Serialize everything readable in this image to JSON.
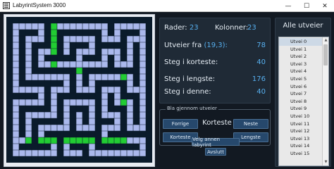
{
  "window": {
    "title": "LabyrintSystem 3000",
    "minimize": "—",
    "maximize": "☐",
    "close": "✕"
  },
  "info": {
    "rader_label": "Rader:",
    "rader_value": "23",
    "kolonner_label": "Kolonner:",
    "kolonner_value": "23",
    "utveier_label": "Utveier fra",
    "utveier_from": "(19,3):",
    "utveier_value": "78",
    "korteste_label": "Steg i korteste:",
    "korteste_value": "40",
    "lengste_label": "Steg i lengste:",
    "lengste_value": "176",
    "denne_label": "Steg i denne:",
    "denne_value": "40"
  },
  "browse": {
    "title": "Bla gjennom utveier",
    "current_label": "Korteste",
    "forrige": "Forrige",
    "neste": "Neste",
    "korteste": "Korteste",
    "lengste": "Lengste"
  },
  "actions": {
    "velg_annen": "Velg annen labyrint",
    "avslutt": "Avslutt"
  },
  "list": {
    "title": "Alle utveier",
    "items": [
      "Utvei 0",
      "Utvei 1",
      "Utvei 2",
      "Utvei 3",
      "Utvei 4",
      "Utvei 5",
      "Utvei 6",
      "Utvei 7",
      "Utvei 8",
      "Utvei 9",
      "Utvei 10",
      "Utvei 11",
      "Utvei 12",
      "Utvei 13",
      "Utvei 14",
      "Utvei 15"
    ],
    "selected": 0
  },
  "maze": {
    "rows": [
      "#######################",
      "#.....#.........#.....#",
      "#.###.#.#######.#.###.#",
      "#.#...#.#.....#...#...#",
      "#.#.###.#.###.#####.#.#",
      "#.#.#...#.#...#...#.#.#",
      "#.#.#.#####.###.#.#.#.#",
      "#.#.#...........#...#.#",
      "#.#.#######.#########.#",
      "#.#.......#.#.......#.#",
      "#.#######.#.#.#####.#.#",
      "#.....#...#...#...#...#",
      "#####.#.#######.#.###.#",
      "#.....#.#.....#.#...#.#",
      "#.#####.#.###.#.###.#.#",
      "#.#.....#.#.#.#...#.#.#",
      "#.#.#####.#.#.###.#.#.#",
      "#.#.#.....#...#...#...#",
      "#.#.#.#########.#######",
      "#...#...#.....#.......#",
      "#.#####.#.###.#######.#",
      "#.......#...#.........#",
      "#######################"
    ],
    "path": [
      [
        19,
        3
      ],
      [
        19,
        4
      ],
      [
        19,
        5
      ],
      [
        19,
        6
      ],
      [
        19,
        7
      ],
      [
        19,
        8
      ],
      [
        19,
        9
      ],
      [
        19,
        10
      ],
      [
        19,
        11
      ],
      [
        19,
        12
      ],
      [
        19,
        13
      ],
      [
        19,
        14
      ],
      [
        19,
        15
      ],
      [
        19,
        16
      ],
      [
        19,
        17
      ],
      [
        19,
        18
      ],
      [
        18,
        18
      ],
      [
        17,
        18
      ],
      [
        16,
        18
      ],
      [
        15,
        18
      ],
      [
        14,
        18
      ],
      [
        13,
        18
      ],
      [
        12,
        18
      ],
      [
        11,
        18
      ],
      [
        10,
        18
      ],
      [
        9,
        18
      ],
      [
        8,
        18
      ],
      [
        8,
        17
      ],
      [
        8,
        16
      ],
      [
        8,
        15
      ],
      [
        8,
        14
      ],
      [
        8,
        13
      ],
      [
        8,
        12
      ],
      [
        8,
        11
      ],
      [
        8,
        10
      ],
      [
        8,
        9
      ],
      [
        8,
        8
      ],
      [
        8,
        7
      ],
      [
        7,
        7
      ],
      [
        6,
        7
      ],
      [
        5,
        7
      ],
      [
        4,
        7
      ],
      [
        3,
        7
      ],
      [
        2,
        7
      ],
      [
        1,
        7
      ]
    ],
    "colors": {
      "wall": "#0a1b2b",
      "open": "#aab8ec",
      "path": "#22cc33"
    }
  }
}
